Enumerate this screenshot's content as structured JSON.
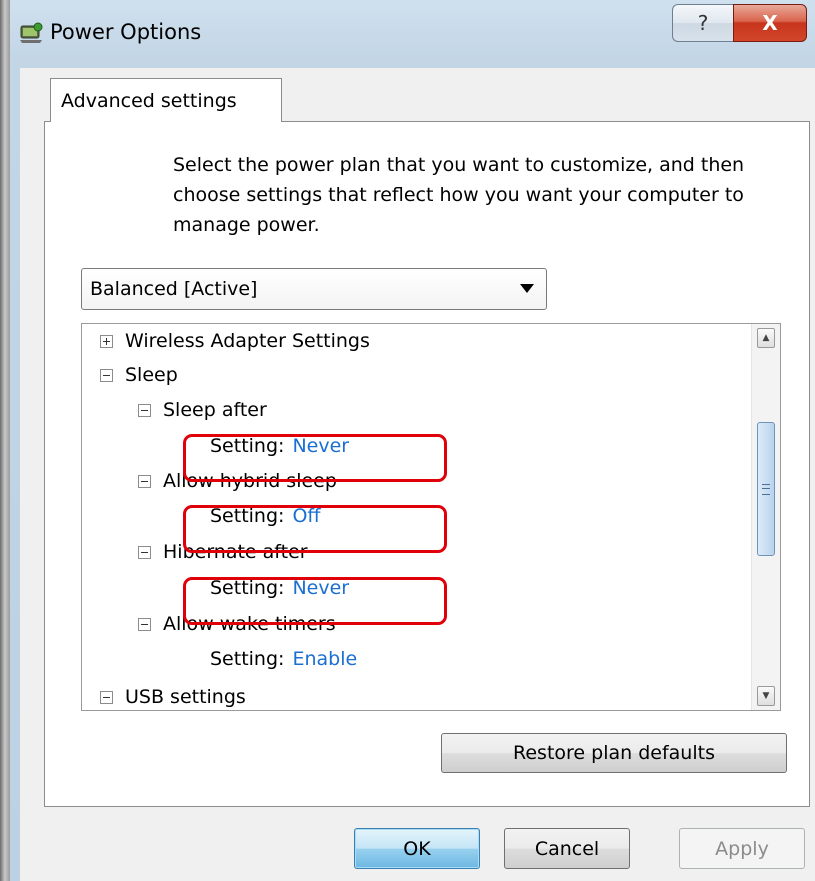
{
  "window": {
    "title": "Power Options",
    "help_label": "?",
    "close_label": "X"
  },
  "tab": {
    "label": "Advanced settings"
  },
  "description": "Select the power plan that you want to customize, and then choose settings that reflect how you want your computer to manage power.",
  "plan_select": {
    "value": "Balanced [Active]"
  },
  "tree": {
    "setting_prefix": "Setting:",
    "wireless": "Wireless Adapter Settings",
    "sleep": "Sleep",
    "sleep_after": "Sleep after",
    "sleep_after_value": "Never",
    "hybrid_sleep": "Allow hybrid sleep",
    "hybrid_sleep_value": "Off",
    "hibernate_after": "Hibernate after",
    "hibernate_after_value": "Never",
    "wake_timers": "Allow wake timers",
    "wake_timers_value": "Enable",
    "usb": "USB settings"
  },
  "buttons": {
    "restore": "Restore plan defaults",
    "ok": "OK",
    "cancel": "Cancel",
    "apply": "Apply"
  },
  "colors": {
    "setting_value": "#1a6fd1",
    "highlight": "#e0000a"
  }
}
